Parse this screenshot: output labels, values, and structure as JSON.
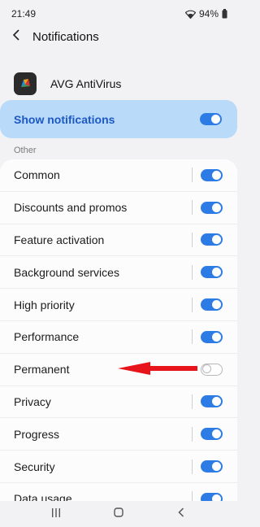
{
  "status_bar": {
    "time": "21:49",
    "battery": "94%"
  },
  "header": {
    "title": "Notifications"
  },
  "app": {
    "name": "AVG AntiVirus"
  },
  "show_notifications": {
    "label": "Show notifications",
    "enabled": true
  },
  "section": {
    "label": "Other"
  },
  "categories": [
    {
      "label": "Common",
      "enabled": true
    },
    {
      "label": "Discounts and promos",
      "enabled": true
    },
    {
      "label": "Feature activation",
      "enabled": true
    },
    {
      "label": "Background services",
      "enabled": true
    },
    {
      "label": "High priority",
      "enabled": true
    },
    {
      "label": "Performance",
      "enabled": true
    },
    {
      "label": "Permanent",
      "enabled": false
    },
    {
      "label": "Privacy",
      "enabled": true
    },
    {
      "label": "Progress",
      "enabled": true
    },
    {
      "label": "Security",
      "enabled": true
    },
    {
      "label": "Data usage",
      "enabled": true
    }
  ],
  "colors": {
    "accent": "#2d7ce6",
    "highlight": "#b9daf8",
    "arrow": "#e8141b"
  },
  "icons": [
    "back-arrow-icon",
    "wifi-icon",
    "battery-icon",
    "recents-icon",
    "home-icon",
    "nav-back-icon"
  ]
}
